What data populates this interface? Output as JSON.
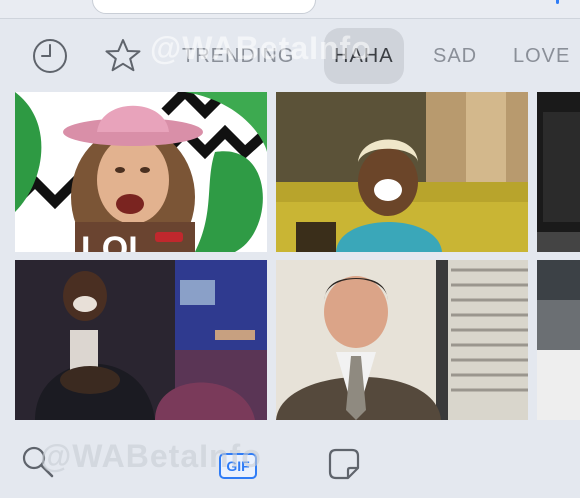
{
  "categories": [
    {
      "label": "TRENDING"
    },
    {
      "label": "HAHA"
    },
    {
      "label": "SAD"
    },
    {
      "label": "LOVE"
    }
  ],
  "active_category": "HAHA",
  "gif_tiles": [
    {
      "caption": "LOL"
    },
    {
      "caption": ""
    },
    {
      "caption": ""
    },
    {
      "caption": ""
    },
    {
      "caption": ""
    },
    {
      "caption": ""
    }
  ],
  "toolbar": {
    "gif_label": "GIF"
  },
  "watermark": {
    "top": "@WABetaInfo",
    "bottom": "@WABetaInfo"
  },
  "icons": [
    "recent-clock-icon",
    "favorites-star-icon",
    "search-icon",
    "gif-icon",
    "sticker-icon"
  ],
  "colors": {
    "accent": "#2f7cf6",
    "background": "#e4e8ef",
    "category_inactive": "#8a8f98",
    "category_active_pill": "#cfd3da"
  }
}
